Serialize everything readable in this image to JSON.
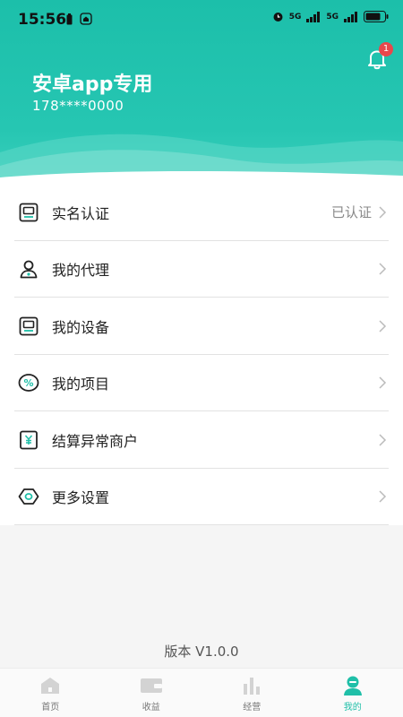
{
  "status_bar": {
    "time": "15:56",
    "network1": "5G",
    "network2": "5G"
  },
  "header": {
    "title": "安卓app专用",
    "phone": "178****0000",
    "notification_badge": "1"
  },
  "menu": {
    "items": [
      {
        "label": "实名认证",
        "value": "已认证",
        "icon": "id-card-icon"
      },
      {
        "label": "我的代理",
        "value": "",
        "icon": "person-icon"
      },
      {
        "label": "我的设备",
        "value": "",
        "icon": "device-icon"
      },
      {
        "label": "我的项目",
        "value": "",
        "icon": "percent-icon"
      },
      {
        "label": "结算异常商户",
        "value": "",
        "icon": "yen-icon"
      },
      {
        "label": "更多设置",
        "value": "",
        "icon": "settings-icon"
      }
    ]
  },
  "version": "版本 V1.0.0",
  "tabbar": {
    "tabs": [
      {
        "label": "首页",
        "icon": "home-icon"
      },
      {
        "label": "收益",
        "icon": "wallet-icon"
      },
      {
        "label": "经营",
        "icon": "bar-chart-icon"
      },
      {
        "label": "我的",
        "icon": "profile-icon"
      }
    ],
    "active_index": 3
  },
  "colors": {
    "accent": "#1fbfa8",
    "header_bg": "#26c6b2",
    "badge": "#e8474c"
  }
}
